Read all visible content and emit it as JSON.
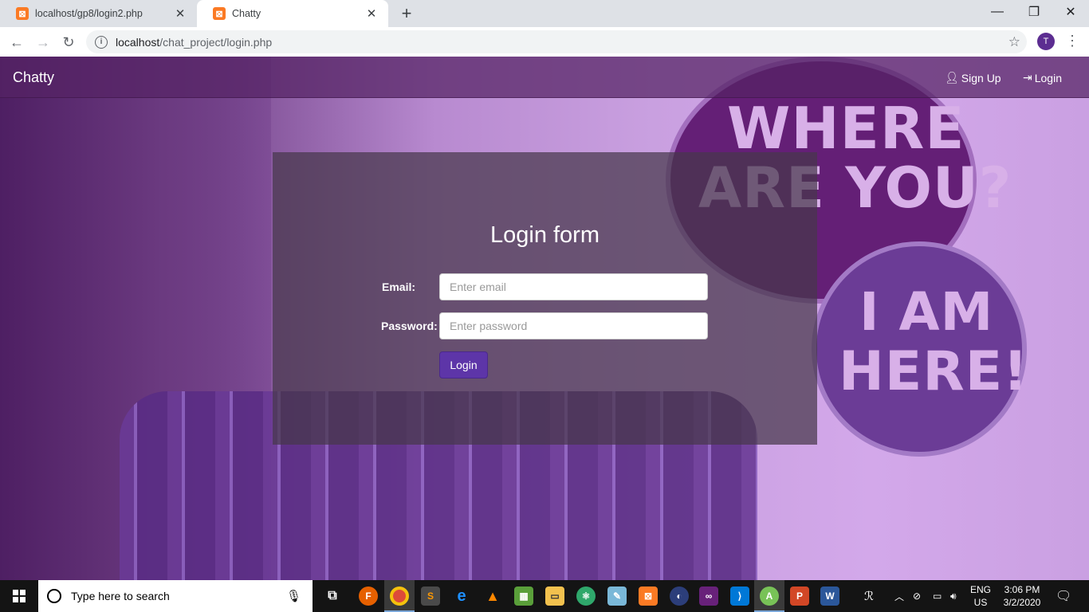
{
  "browser": {
    "tabs": [
      {
        "title": "localhost/gp8/login2.php",
        "active": false
      },
      {
        "title": "Chatty",
        "active": true
      }
    ],
    "url_host": "localhost",
    "url_path": "/chat_project/login.php",
    "profile_initial": "T"
  },
  "navbar": {
    "brand": "Chatty",
    "signup_label": "Sign Up",
    "login_label": "Login"
  },
  "background": {
    "bubble_top_line1": "WHERE",
    "bubble_top_line2": "ARE YOU?",
    "bubble_bottom_line1": "I AM",
    "bubble_bottom_line2": "HERE!"
  },
  "form": {
    "title": "Login form",
    "email_label": "Email:",
    "email_placeholder": "Enter email",
    "password_label": "Password:",
    "password_placeholder": "Enter password",
    "submit_label": "Login"
  },
  "taskbar": {
    "search_placeholder": "Type here to search",
    "lang_line1": "ENG",
    "lang_line2": "US",
    "time": "3:06 PM",
    "date": "3/2/2020"
  },
  "colors": {
    "accent": "#5d35a8",
    "navbar": "#552364",
    "panel": "#46374b"
  }
}
